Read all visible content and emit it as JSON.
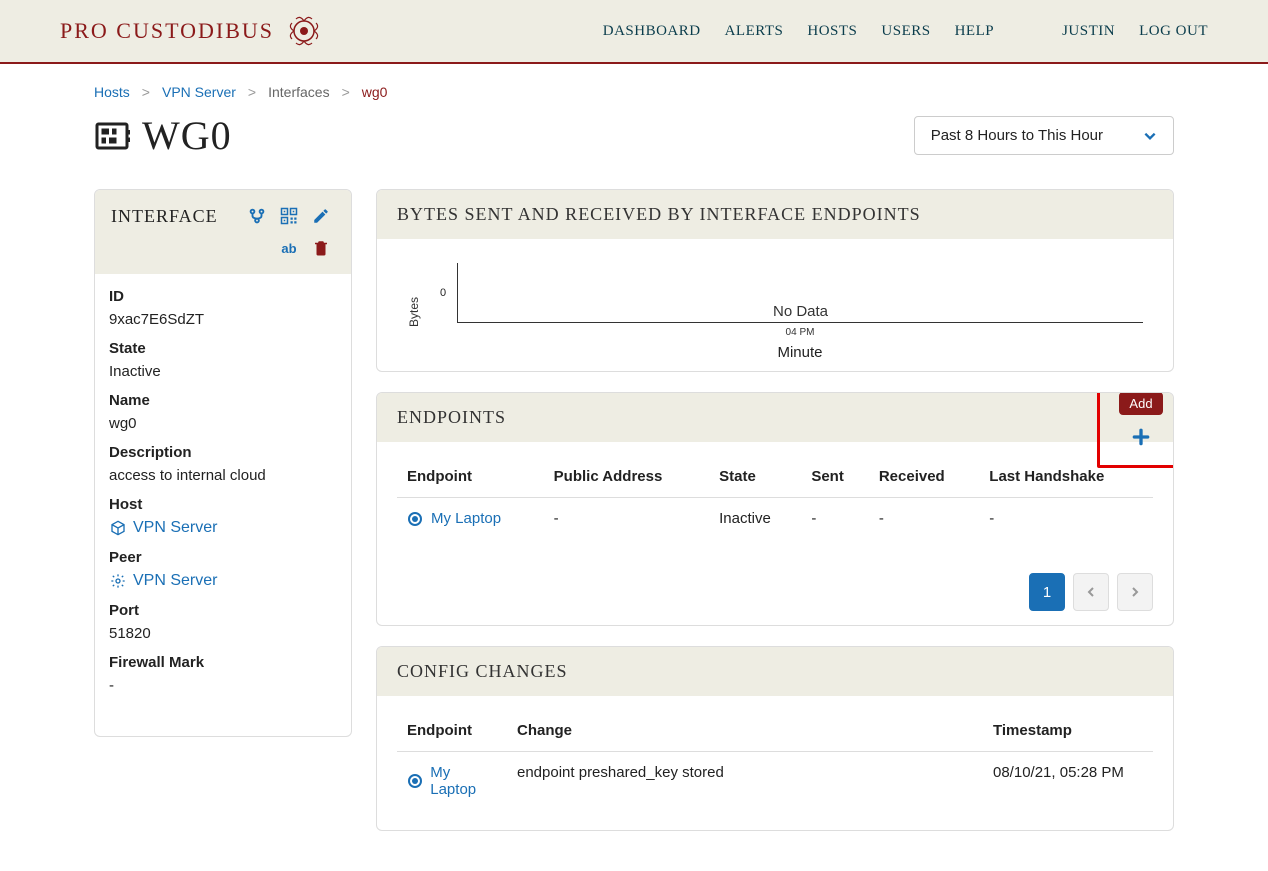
{
  "brand": "PRO CUSTODIBUS",
  "nav": {
    "dashboard": "DASHBOARD",
    "alerts": "ALERTS",
    "hosts": "HOSTS",
    "users": "USERS",
    "help": "HELP",
    "user": "JUSTIN",
    "logout": "LOG OUT"
  },
  "breadcrumb": {
    "hosts": "Hosts",
    "vpn": "VPN Server",
    "interfaces": "Interfaces",
    "current": "wg0"
  },
  "title": "WG0",
  "time_range": "Past 8 Hours to This Hour",
  "side": {
    "title": "INTERFACE",
    "fields": {
      "id_label": "ID",
      "id": "9xac7E6SdZT",
      "state_label": "State",
      "state": "Inactive",
      "name_label": "Name",
      "name": "wg0",
      "desc_label": "Description",
      "desc": "access to internal cloud",
      "host_label": "Host",
      "host": "VPN Server",
      "peer_label": "Peer",
      "peer": "VPN Server",
      "port_label": "Port",
      "port": "51820",
      "fw_label": "Firewall Mark",
      "fw": "-"
    }
  },
  "chart_data": {
    "type": "line",
    "title": "BYTES SENT AND RECEIVED BY INTERFACE ENDPOINTS",
    "ylabel": "Bytes",
    "xlabel": "Minute",
    "x_ticks": [
      "04 PM"
    ],
    "y_ticks": [
      "0"
    ],
    "series": [],
    "no_data_text": "No Data"
  },
  "endpoints": {
    "title": "ENDPOINTS",
    "add_tooltip": "Add",
    "cols": {
      "endpoint": "Endpoint",
      "pub": "Public Address",
      "state": "State",
      "sent": "Sent",
      "recv": "Received",
      "last": "Last Handshake"
    },
    "rows": [
      {
        "endpoint": "My Laptop",
        "pub": "-",
        "state": "Inactive",
        "sent": "-",
        "recv": "-",
        "last": "-"
      }
    ],
    "page": "1"
  },
  "config": {
    "title": "CONFIG CHANGES",
    "cols": {
      "endpoint": "Endpoint",
      "change": "Change",
      "ts": "Timestamp"
    },
    "rows": [
      {
        "endpoint": "My Laptop",
        "change": "endpoint preshared_key stored",
        "ts": "08/10/21, 05:28 PM"
      }
    ]
  }
}
